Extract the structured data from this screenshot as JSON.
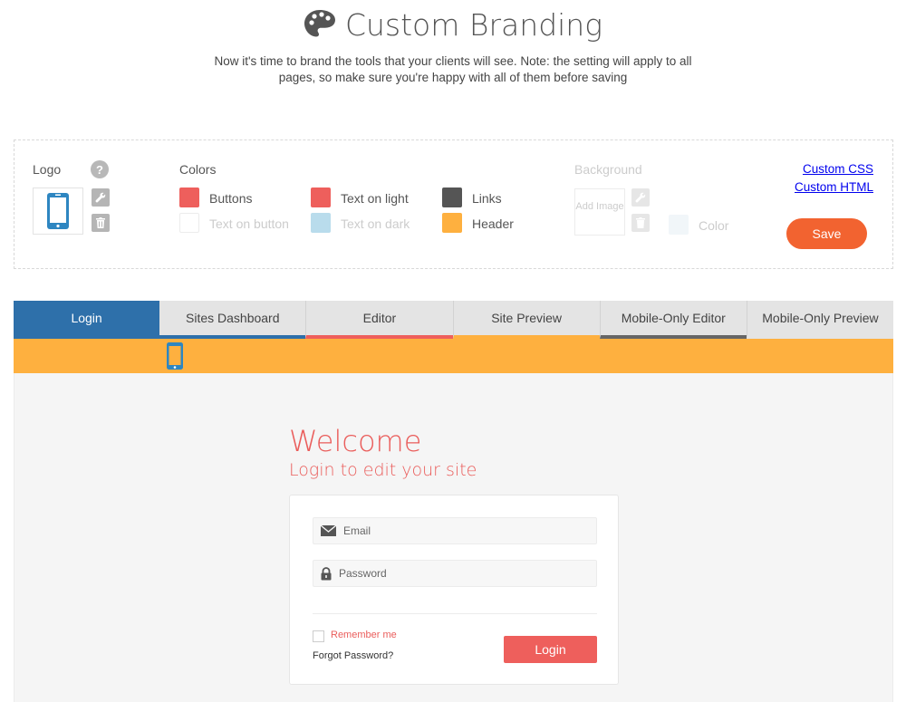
{
  "page": {
    "title": "Custom Branding",
    "subtitle": "Now it's time to brand the tools that your clients will see. Note: the setting will apply to all pages, so make sure you're happy with all of them before saving"
  },
  "settings": {
    "logo_label": "Logo",
    "help_glyph": "?",
    "colors_label": "Colors",
    "colors": [
      {
        "label": "Buttons",
        "color": "#ee5f5c"
      },
      {
        "label": "Text on button",
        "color": "#ffffff"
      },
      {
        "label": "Text on light",
        "color": "#ee5f5c"
      },
      {
        "label": "Text on dark",
        "color": "#b9dcec"
      },
      {
        "label": "Links",
        "color": "#555555"
      },
      {
        "label": "Header",
        "color": "#feb03f"
      }
    ],
    "background_label": "Background",
    "add_image_label": "Add Image",
    "bg_color_label": "Color",
    "bg_color": "#f1f6f9",
    "custom_css_label": "Custom CSS",
    "custom_html_label": "Custom HTML",
    "save_label": "Save"
  },
  "tabs": [
    {
      "label": "Login",
      "active": true,
      "accent": "#2e70aa"
    },
    {
      "label": "Sites Dashboard",
      "accent": "#2e70aa"
    },
    {
      "label": "Editor",
      "accent": "#ee5f5c"
    },
    {
      "label": "Site Preview",
      "accent": "#feb03f"
    },
    {
      "label": "Mobile-Only Editor",
      "accent": "#666666"
    },
    {
      "label": "Mobile-Only Preview",
      "accent": "#e4e4e4"
    }
  ],
  "preview": {
    "header_color": "#feb03f",
    "logo_icon": "mobile-phone-icon",
    "welcome": "Welcome",
    "welcome_sub": "Login to edit your site",
    "email_placeholder": "Email",
    "password_placeholder": "Password",
    "remember_label": "Remember me",
    "forgot_label": "Forgot Password?",
    "login_label": "Login"
  },
  "colors": {
    "accent_blue": "#2e70aa",
    "accent_red": "#ee5f5c",
    "save_orange": "#f26330"
  }
}
